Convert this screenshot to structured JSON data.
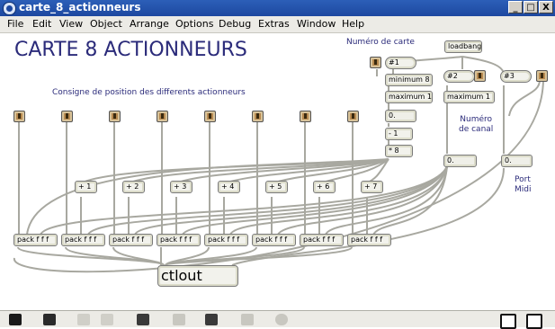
{
  "window": {
    "title": "carte_8_actionneurs",
    "minimize": "_",
    "maximize": "□",
    "close": "X"
  },
  "menu": [
    "File",
    "Edit",
    "View",
    "Object",
    "Arrange",
    "Options",
    "Debug",
    "Extras",
    "Window",
    "Help"
  ],
  "patch": {
    "title": "CARTE 8 ACTIONNEURS",
    "subtitle": "Consigne de position des differents actionneurs",
    "label_numero_carte": "Numéro de carte",
    "label_numero_canal": "Numéro\nde canal",
    "label_numero_canal_1": "Numéro",
    "label_numero_canal_2": "de canal",
    "label_port_1": "Port",
    "label_port_2": "Midi",
    "obj_loadbang": "loadbang",
    "obj_arg1": "#1",
    "obj_arg2": "#2",
    "obj_arg3": "#3",
    "obj_minimum": "minimum 8",
    "obj_maximum_a": "maximum 1",
    "obj_maximum_b": "maximum 1",
    "num_a": "0.",
    "num_b": "0.",
    "num_c": "0.",
    "obj_minus": "- 1",
    "obj_times": "* 8",
    "adders": [
      "+ 1",
      "+ 2",
      "+ 3",
      "+ 4",
      "+ 5",
      "+ 6",
      "+ 7"
    ],
    "packs": [
      "pack f f f",
      "pack f f f",
      "pack f f f",
      "pack f f f",
      "pack f f f",
      "pack f f f",
      "pack f f f",
      "pack f f f"
    ],
    "ctlout": "ctlout"
  },
  "status_icons": [
    "lock-icon",
    "new-object-icon",
    "link-icon",
    "close-box-icon",
    "graph-icon",
    "info-icon",
    "camera-icon",
    "grid-icon",
    "gear-icon",
    "toggle-a-icon",
    "toggle-b-icon"
  ]
}
